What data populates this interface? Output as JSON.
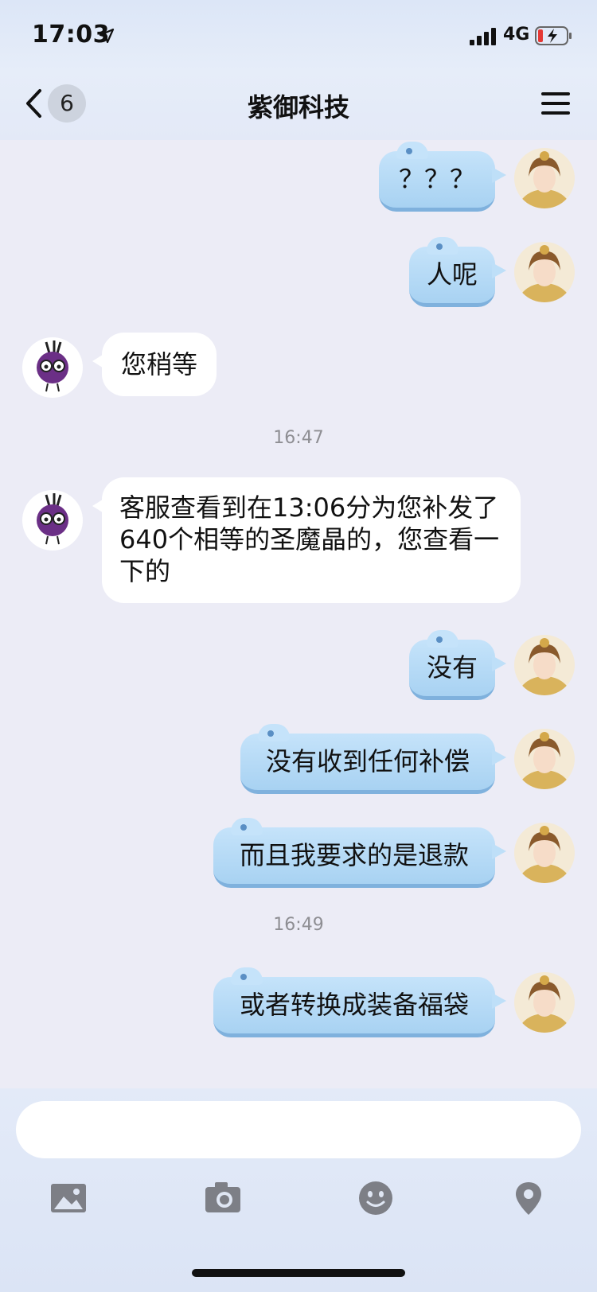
{
  "status_bar": {
    "time": "17:03",
    "network": "4G"
  },
  "header": {
    "back_badge": "6",
    "title": "紫御科技"
  },
  "messages": [
    {
      "side": "out",
      "text": "？？？"
    },
    {
      "side": "out",
      "text": "人呢"
    },
    {
      "side": "in",
      "text": "您稍等"
    },
    {
      "type": "timestamp",
      "text": "16:47"
    },
    {
      "side": "in",
      "text": "客服查看到在13:06分为您补发了640个相等的圣魔晶的，您查看一下的"
    },
    {
      "side": "out",
      "text": "没有"
    },
    {
      "side": "out",
      "text": "没有收到任何补偿"
    },
    {
      "side": "out",
      "text": "而且我要求的是退款"
    },
    {
      "type": "timestamp",
      "text": "16:49"
    },
    {
      "side": "out",
      "text": "或者转换成装备福袋"
    }
  ],
  "input": {
    "value": "",
    "placeholder": ""
  },
  "toolbar": {
    "icons": [
      "image-icon",
      "camera-icon",
      "emoji-icon",
      "location-icon"
    ]
  },
  "colors": {
    "outgoing_bubble": "#b6dbf7",
    "incoming_bubble": "#ffffff",
    "background": "#ececf6",
    "agent_avatar": "#6b2f86"
  }
}
